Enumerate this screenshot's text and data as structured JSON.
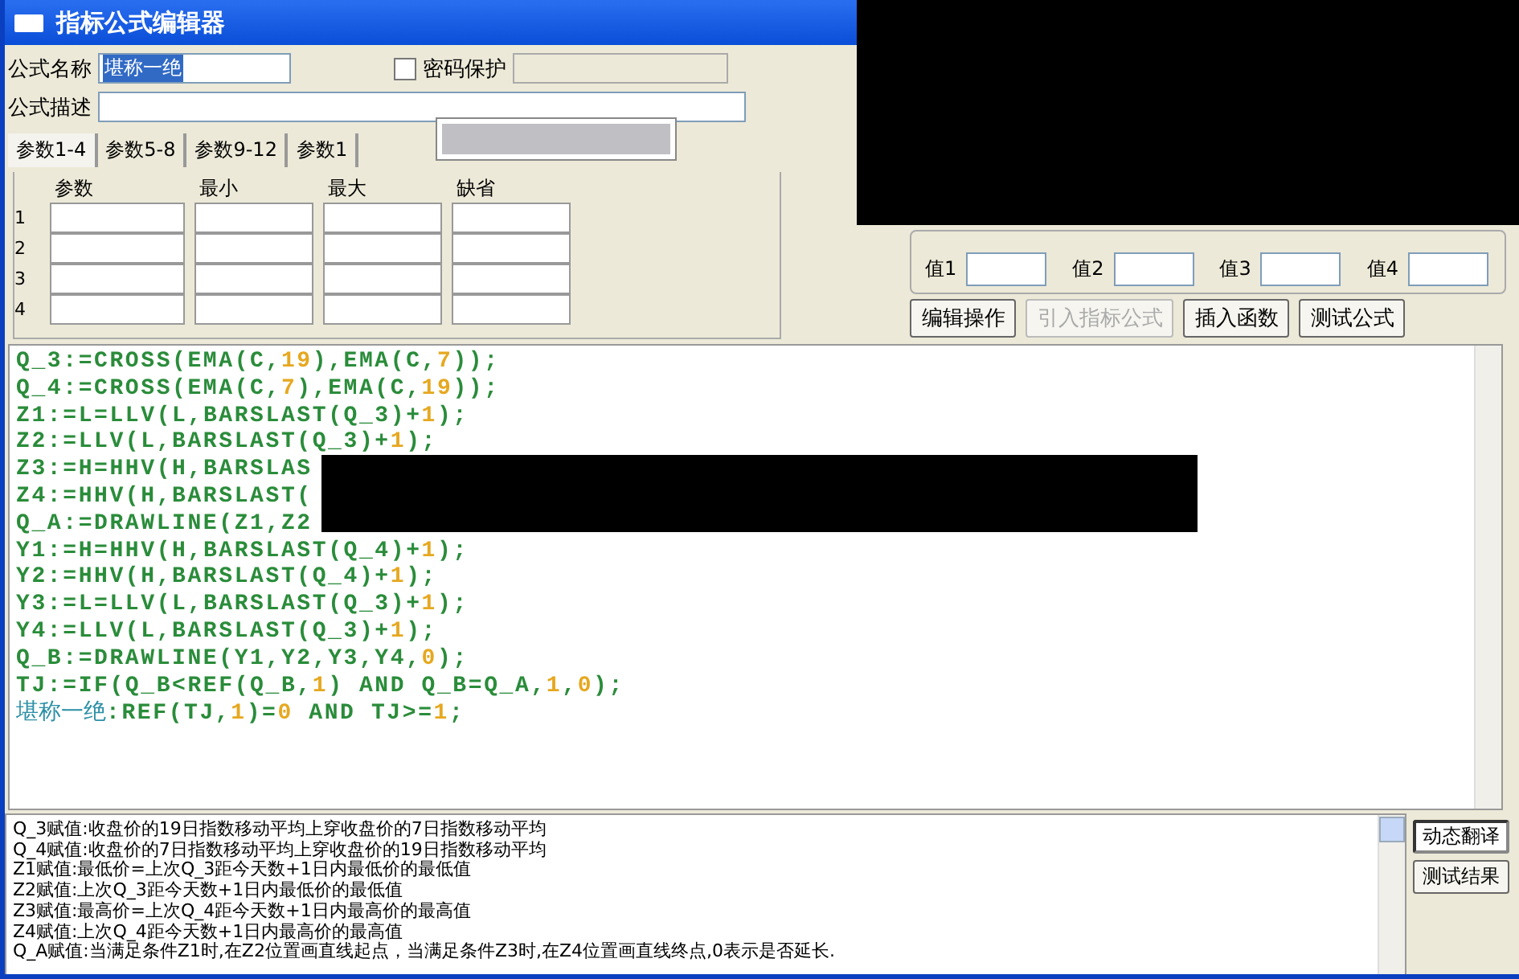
{
  "window": {
    "title": "指标公式编辑器"
  },
  "formula_name": {
    "label": "公式名称",
    "value": "堪称一绝",
    "highlighted": true
  },
  "password": {
    "label": "密码保护",
    "checked": false
  },
  "description": {
    "label": "公式描述"
  },
  "tabs": [
    {
      "label": "参数1-4",
      "selected": true
    },
    {
      "label": "参数5-8",
      "selected": false
    },
    {
      "label": "参数9-12",
      "selected": false
    },
    {
      "label": "参数1",
      "selected": false
    }
  ],
  "param_table": {
    "columns": [
      "参数",
      "最小",
      "最大",
      "缺省"
    ],
    "rows": [
      "1",
      "2",
      "3",
      "4"
    ]
  },
  "axis_values": [
    {
      "label": "值1"
    },
    {
      "label": "值2"
    },
    {
      "label": "值3"
    },
    {
      "label": "值4"
    }
  ],
  "buttons": [
    {
      "label": "编辑操作",
      "disabled": false
    },
    {
      "label": "引入指标公式",
      "disabled": true
    },
    {
      "label": "插入函数",
      "disabled": false
    },
    {
      "label": "测试公式",
      "disabled": false
    }
  ],
  "code_lines": [
    "Q_3:=CROSS(EMA(C,19),EMA(C,7));",
    "Q_4:=CROSS(EMA(C,7),EMA(C,19));",
    "Z1:=L=LLV(L,BARSLAST(Q_3)+1);",
    "Z2:=LLV(L,BARSLAST(Q_3)+1);",
    "Z3:=H=HHV(H,BARSLAS",
    "Z4:=HHV(H,BARSLAST(",
    "Q_A:=DRAWLINE(Z1,Z2",
    "Y1:=H=HHV(H,BARSLAST(Q_4)+1);",
    "Y2:=HHV(H,BARSLAST(Q_4)+1);",
    "Y3:=L=LLV(L,BARSLAST(Q_3)+1);",
    "Y4:=LLV(L,BARSLAST(Q_3)+1);",
    "Q_B:=DRAWLINE(Y1,Y2,Y3,Y4,0);",
    "TJ:=IF(Q_B<REF(Q_B,1) AND Q_B=Q_A,1,0);",
    "堪称一绝:REF(TJ,1)=0 AND TJ>=1;"
  ],
  "translation_lines": [
    "Q_3赋值:收盘价的19日指数移动平均上穿收盘价的7日指数移动平均",
    "Q_4赋值:收盘价的7日指数移动平均上穿收盘价的19日指数移动平均",
    "Z1赋值:最低价=上次Q_3距今天数+1日内最低价的最低值",
    "Z2赋值:上次Q_3距今天数+1日内最低价的最低值",
    "Z3赋值:最高价=上次Q_4距今天数+1日内最高价的最高值",
    "Z4赋值:上次Q_4距今天数+1日内最高价的最高值",
    "Q_A赋值:当满足条件Z1时,在Z2位置画直线起点，当满足条件Z3时,在Z4位置画直线终点,0表示是否延长."
  ],
  "side_buttons": [
    {
      "label": "动态翻译",
      "selected": true
    },
    {
      "label": "测试结果",
      "selected": false
    }
  ]
}
